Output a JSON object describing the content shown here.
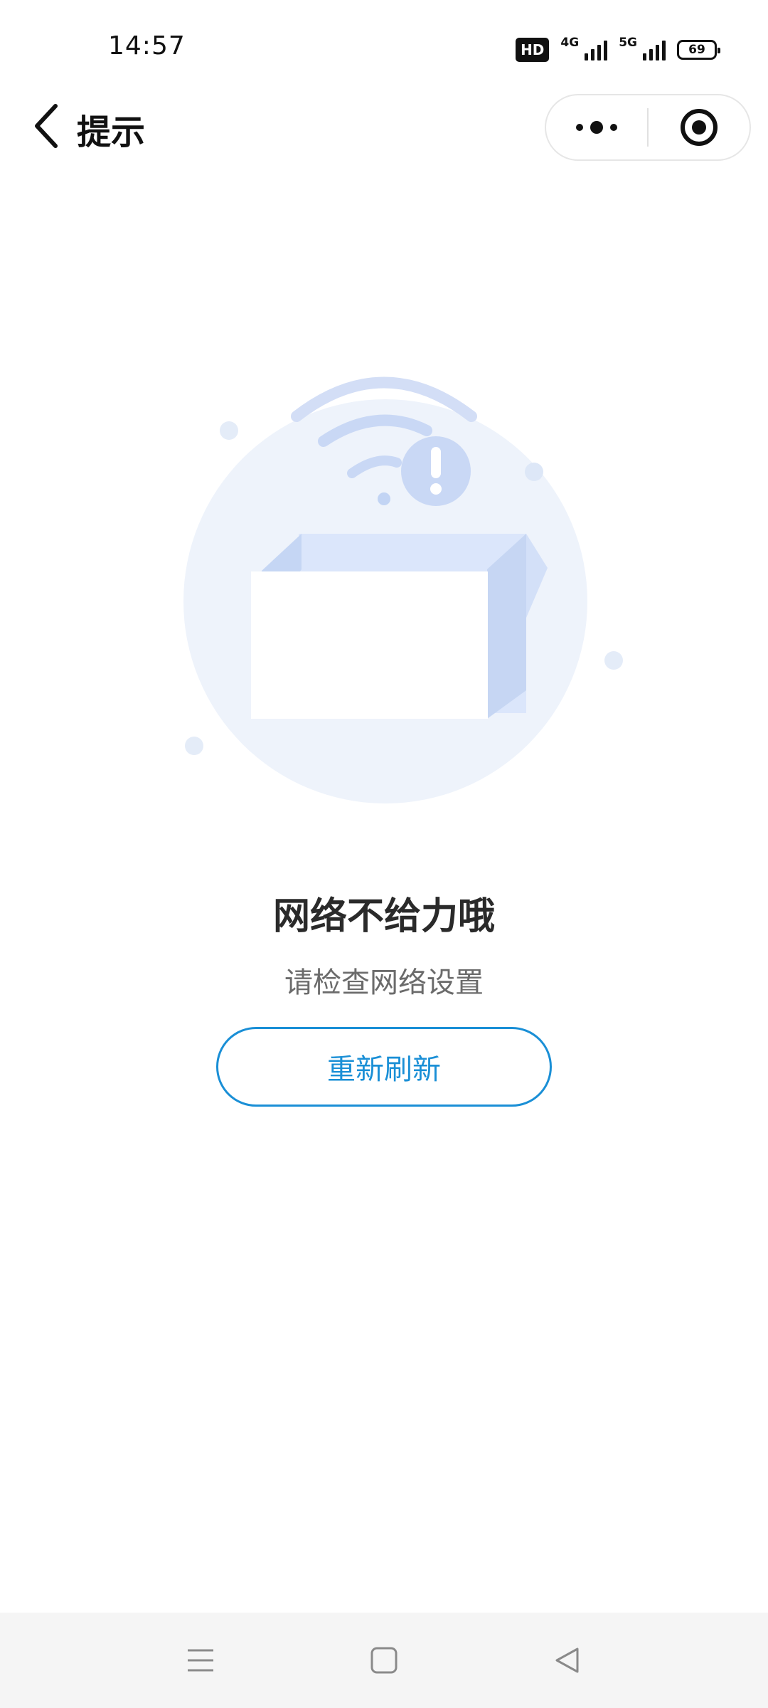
{
  "status_bar": {
    "time": "14:57",
    "hd_label": "HD",
    "network_1": "4G",
    "network_2": "5G",
    "battery_level": "69"
  },
  "nav": {
    "title": "提示",
    "back_icon": "chevron-left-icon",
    "more_icon": "more-dots-icon",
    "close_icon": "target-circle-icon"
  },
  "content": {
    "error_title": "网络不给力哦",
    "error_subtitle": "请检查网络设置",
    "refresh_label": "重新刷新",
    "illustration": "no-network-box-illustration"
  },
  "bottom_nav": {
    "menu_icon": "menu-lines-icon",
    "home_icon": "square-home-icon",
    "back_icon": "triangle-back-icon"
  },
  "colors": {
    "accent": "#1a8fd6",
    "illustration_light": "#eef3fb",
    "illustration_mid": "#c9d8f5",
    "illustration_dark": "#b7cbf0"
  }
}
